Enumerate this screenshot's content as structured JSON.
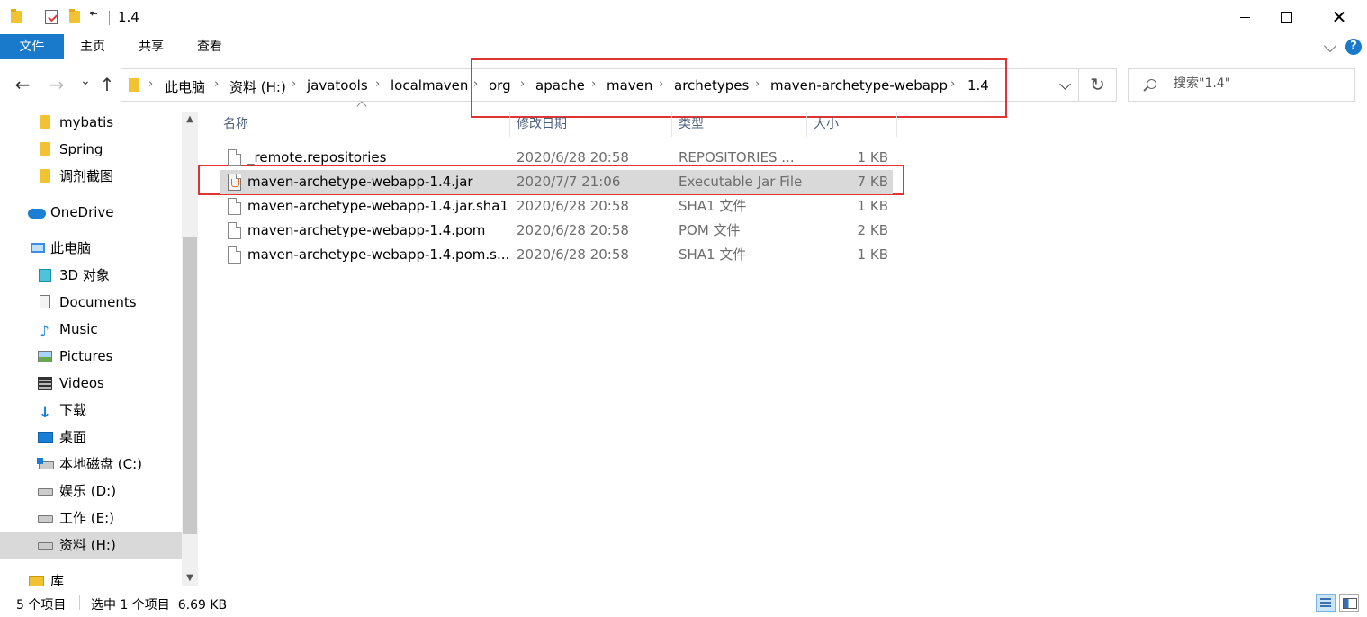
{
  "window": {
    "title": "1.4",
    "minimize": "",
    "maximize": "",
    "close": "✕"
  },
  "ribbon": {
    "tabs": [
      "文件",
      "主页",
      "共享",
      "查看"
    ]
  },
  "nav": {
    "back": "←",
    "forward": "→",
    "recent": "⌄",
    "up": "↑",
    "refresh": "↻"
  },
  "address": {
    "crumbs": [
      "此电脑",
      "资料 (H:)",
      "javatools",
      "localmaven",
      "org",
      "apache",
      "maven",
      "archetypes",
      "maven-archetype-webapp",
      "1.4"
    ],
    "separator": "›"
  },
  "search": {
    "placeholder": "搜索\"1.4\""
  },
  "sidebar": {
    "items": [
      {
        "label": "mybatis",
        "icon": "folder-icon"
      },
      {
        "label": "Spring",
        "icon": "folder-icon"
      },
      {
        "label": "调剂截图",
        "icon": "folder-icon"
      },
      {
        "label": "OneDrive",
        "icon": "onedrive-icon"
      },
      {
        "label": "此电脑",
        "icon": "computer-icon"
      },
      {
        "label": "3D 对象",
        "icon": "3d-objects-icon"
      },
      {
        "label": "Documents",
        "icon": "documents-icon"
      },
      {
        "label": "Music",
        "icon": "music-icon"
      },
      {
        "label": "Pictures",
        "icon": "pictures-icon"
      },
      {
        "label": "Videos",
        "icon": "videos-icon"
      },
      {
        "label": "下载",
        "icon": "downloads-icon"
      },
      {
        "label": "桌面",
        "icon": "desktop-icon"
      },
      {
        "label": "本地磁盘 (C:)",
        "icon": "system-drive-icon"
      },
      {
        "label": "娱乐 (D:)",
        "icon": "drive-icon"
      },
      {
        "label": "工作 (E:)",
        "icon": "drive-icon"
      },
      {
        "label": "资料 (H:)",
        "icon": "drive-icon"
      },
      {
        "label": "库",
        "icon": "library-icon"
      }
    ],
    "selected_index": 15
  },
  "columns": {
    "name": "名称",
    "date": "修改日期",
    "type": "类型",
    "size": "大小"
  },
  "files": [
    {
      "name": "_remote.repositories",
      "date": "2020/6/28 20:58",
      "type": "REPOSITORIES ...",
      "size": "1 KB",
      "icon": "file-icon"
    },
    {
      "name": "maven-archetype-webapp-1.4.jar",
      "date": "2020/7/7 21:06",
      "type": "Executable Jar File",
      "size": "7 KB",
      "icon": "jar-file-icon"
    },
    {
      "name": "maven-archetype-webapp-1.4.jar.sha1",
      "date": "2020/6/28 20:58",
      "type": "SHA1 文件",
      "size": "1 KB",
      "icon": "file-icon"
    },
    {
      "name": "maven-archetype-webapp-1.4.pom",
      "date": "2020/6/28 20:58",
      "type": "POM 文件",
      "size": "2 KB",
      "icon": "file-icon"
    },
    {
      "name": "maven-archetype-webapp-1.4.pom.s...",
      "date": "2020/6/28 20:58",
      "type": "SHA1 文件",
      "size": "1 KB",
      "icon": "file-icon"
    }
  ],
  "selected_file_index": 1,
  "status": {
    "item_count": "5 个项目",
    "selection": "选中 1 个项目  6.69 KB"
  },
  "colors": {
    "accent": "#1979ca",
    "selection": "#d9d9d9",
    "highlight_box": "#e03333"
  }
}
